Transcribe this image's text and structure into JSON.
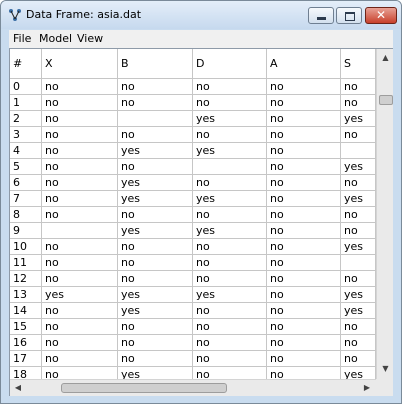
{
  "window": {
    "title": "Data Frame: asia.dat",
    "close_glyph": "✕"
  },
  "icons": {
    "app": "data-frame-icon",
    "minimize": "minimize-icon",
    "maximize": "maximize-icon",
    "close": "close-icon"
  },
  "menu": {
    "file": "File",
    "model": "Model",
    "view": "View"
  },
  "table": {
    "columns": [
      "#",
      "X",
      "B",
      "D",
      "A",
      "S"
    ],
    "rows": [
      [
        "0",
        "no",
        "no",
        "no",
        "no",
        "no"
      ],
      [
        "1",
        "no",
        "no",
        "no",
        "no",
        "no"
      ],
      [
        "2",
        "no",
        "",
        "yes",
        "no",
        "yes"
      ],
      [
        "3",
        "no",
        "no",
        "no",
        "no",
        "no"
      ],
      [
        "4",
        "no",
        "yes",
        "yes",
        "no",
        ""
      ],
      [
        "5",
        "no",
        "no",
        "",
        "no",
        "yes"
      ],
      [
        "6",
        "no",
        "yes",
        "no",
        "no",
        "no"
      ],
      [
        "7",
        "no",
        "yes",
        "yes",
        "no",
        "yes"
      ],
      [
        "8",
        "no",
        "no",
        "no",
        "no",
        "no"
      ],
      [
        "9",
        "",
        "yes",
        "yes",
        "no",
        "no"
      ],
      [
        "10",
        "no",
        "no",
        "no",
        "no",
        "yes"
      ],
      [
        "11",
        "no",
        "no",
        "no",
        "no",
        ""
      ],
      [
        "12",
        "no",
        "no",
        "no",
        "no",
        "no"
      ],
      [
        "13",
        "yes",
        "yes",
        "yes",
        "no",
        "yes"
      ],
      [
        "14",
        "no",
        "yes",
        "no",
        "no",
        "yes"
      ],
      [
        "15",
        "no",
        "no",
        "no",
        "no",
        "no"
      ],
      [
        "16",
        "no",
        "no",
        "no",
        "no",
        "no"
      ],
      [
        "17",
        "no",
        "no",
        "no",
        "no",
        "no"
      ],
      [
        "18",
        "no",
        "yes",
        "no",
        "no",
        "yes"
      ]
    ]
  },
  "scroll": {
    "up": "▲",
    "down": "▼",
    "left": "◀",
    "right": "▶"
  }
}
